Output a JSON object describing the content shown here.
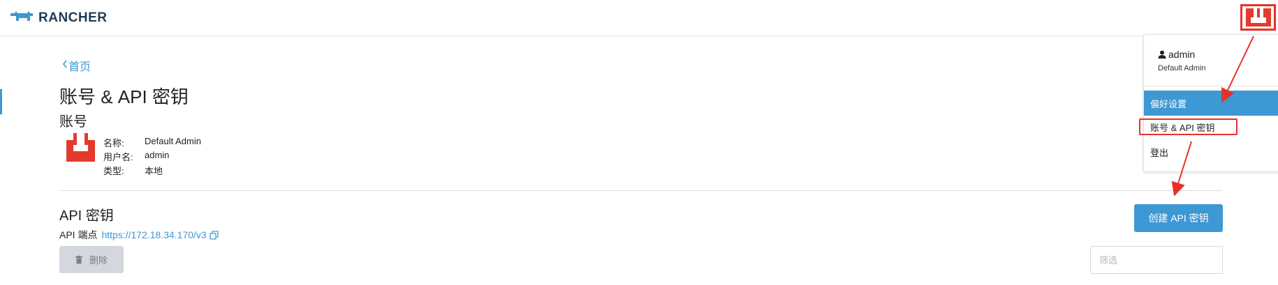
{
  "header": {
    "brand": "RANCHER"
  },
  "nav": {
    "back_label": "首页"
  },
  "page": {
    "title": "账号 & API 密钥"
  },
  "account": {
    "section_title": "账号",
    "fields": [
      {
        "label": "名称:",
        "value": "Default Admin"
      },
      {
        "label": "用户名:",
        "value": "admin"
      },
      {
        "label": "类型:",
        "value": "本地"
      }
    ]
  },
  "api": {
    "section_title": "API 密钥",
    "endpoint_label": "API 端点",
    "endpoint_url": "https://172.18.34.170/v3",
    "delete_label": "删除",
    "create_label": "创建 API 密钥",
    "filter_placeholder": "筛选"
  },
  "user_menu": {
    "username": "admin",
    "role": "Default Admin",
    "items": [
      {
        "label": "偏好设置"
      },
      {
        "label": "账号 & API 密钥"
      },
      {
        "label": "登出"
      }
    ]
  },
  "colors": {
    "accent": "#3d98d3",
    "annotation": "#e8302a",
    "brand": "#1f3b57"
  }
}
